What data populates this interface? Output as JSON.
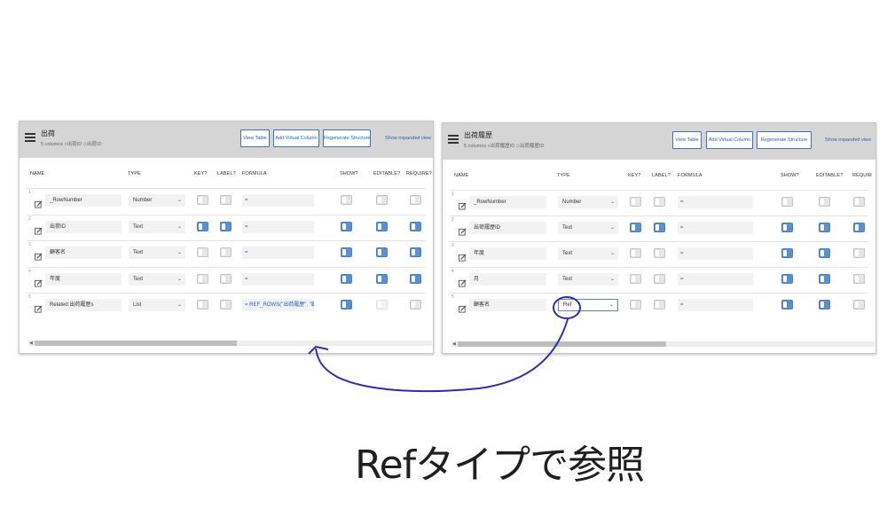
{
  "left_table": {
    "title": "出荷",
    "meta": "5 columns  ⌕出荷ID  ◇出荷ID",
    "buttons": {
      "view_table": "View Table",
      "add_virtual": "Add Virtual Column",
      "regenerate": "Regenerate Structure"
    },
    "expanded_link": "Show expanded view",
    "headers": {
      "name": "NAME",
      "type": "TYPE",
      "key": "KEY?",
      "label": "LABEL?",
      "formula": "FORMULA",
      "show": "SHOW?",
      "editable": "EDITABLE?",
      "require": "REQUIRE?"
    },
    "rows": [
      {
        "num": "1",
        "name": "_RowNumber",
        "type": "Number",
        "key": false,
        "label": false,
        "formula": "=",
        "show": false,
        "editable": false,
        "require": false
      },
      {
        "num": "2",
        "name": "出荷ID",
        "type": "Text",
        "key": true,
        "label": true,
        "formula": "=",
        "show": true,
        "editable": true,
        "require": true
      },
      {
        "num": "3",
        "name": "顧客名",
        "type": "Text",
        "key": false,
        "label": false,
        "formula": "=",
        "show": true,
        "editable": true,
        "require": true
      },
      {
        "num": "4",
        "name": "年度",
        "type": "Text",
        "key": false,
        "label": false,
        "formula": "=",
        "show": true,
        "editable": true,
        "require": true
      },
      {
        "num": "5",
        "name": "Related 出荷履歴s",
        "type": "List",
        "key": false,
        "label": false,
        "formula": "=   REF_ROWS(\"出荷履歴\", \"顧",
        "show": true,
        "editable": false,
        "require": false
      }
    ]
  },
  "right_table": {
    "title": "出荷履歴",
    "meta": "5 columns  ⌕出荷履歴ID  ◇出荷履歴ID",
    "buttons": {
      "view_table": "View Table",
      "add_virtual": "Add Virtual Column",
      "regenerate": "Regenerate Structure"
    },
    "expanded_link": "Show expanded view",
    "headers": {
      "name": "NAME",
      "type": "TYPE",
      "key": "KEY?",
      "label": "LABEL?",
      "formula": "FORMULA",
      "show": "SHOW?",
      "editable": "EDITABLE?",
      "require": "REQUIR"
    },
    "rows": [
      {
        "num": "1",
        "name": "_RowNumber",
        "type": "Number",
        "key": false,
        "label": false,
        "formula": "=",
        "show": false,
        "editable": false,
        "require": false
      },
      {
        "num": "2",
        "name": "出荷履歴ID",
        "type": "Text",
        "key": true,
        "label": true,
        "formula": "=",
        "show": true,
        "editable": true,
        "require": true
      },
      {
        "num": "3",
        "name": "年度",
        "type": "Text",
        "key": false,
        "label": false,
        "formula": "=",
        "show": true,
        "editable": true,
        "require": false
      },
      {
        "num": "4",
        "name": "月",
        "type": "Text",
        "key": false,
        "label": false,
        "formula": "=",
        "show": true,
        "editable": true,
        "require": false
      },
      {
        "num": "5",
        "name": "顧客名",
        "type": "Ref",
        "key": false,
        "label": false,
        "formula": "=",
        "show": true,
        "editable": true,
        "require": false
      }
    ]
  },
  "caption": "Refタイプで参照",
  "annotation_color": "#2b2fb0"
}
